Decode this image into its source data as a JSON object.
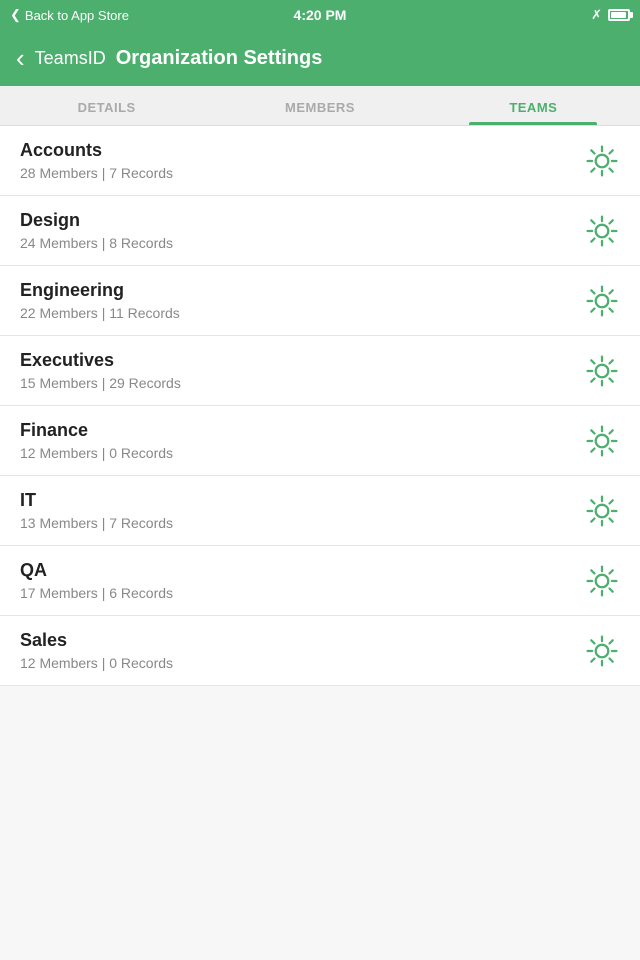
{
  "statusBar": {
    "backLabel": "Back to App Store",
    "time": "4:20 PM"
  },
  "navBar": {
    "backChevron": "‹",
    "appName": "TeamsID",
    "pageTitle": "Organization Settings"
  },
  "tabs": [
    {
      "id": "details",
      "label": "DETAILS",
      "active": false
    },
    {
      "id": "members",
      "label": "MEMBERS",
      "active": false
    },
    {
      "id": "teams",
      "label": "TEAMS",
      "active": true
    }
  ],
  "teams": [
    {
      "name": "Accounts",
      "members": 28,
      "records": 7
    },
    {
      "name": "Design",
      "members": 24,
      "records": 8
    },
    {
      "name": "Engineering",
      "members": 22,
      "records": 11
    },
    {
      "name": "Executives",
      "members": 15,
      "records": 29
    },
    {
      "name": "Finance",
      "members": 12,
      "records": 0
    },
    {
      "name": "IT",
      "members": 13,
      "records": 7
    },
    {
      "name": "QA",
      "members": 17,
      "records": 6
    },
    {
      "name": "Sales",
      "members": 12,
      "records": 0
    }
  ],
  "colors": {
    "green": "#4caf6e",
    "gearStroke": "#4caf6e"
  }
}
